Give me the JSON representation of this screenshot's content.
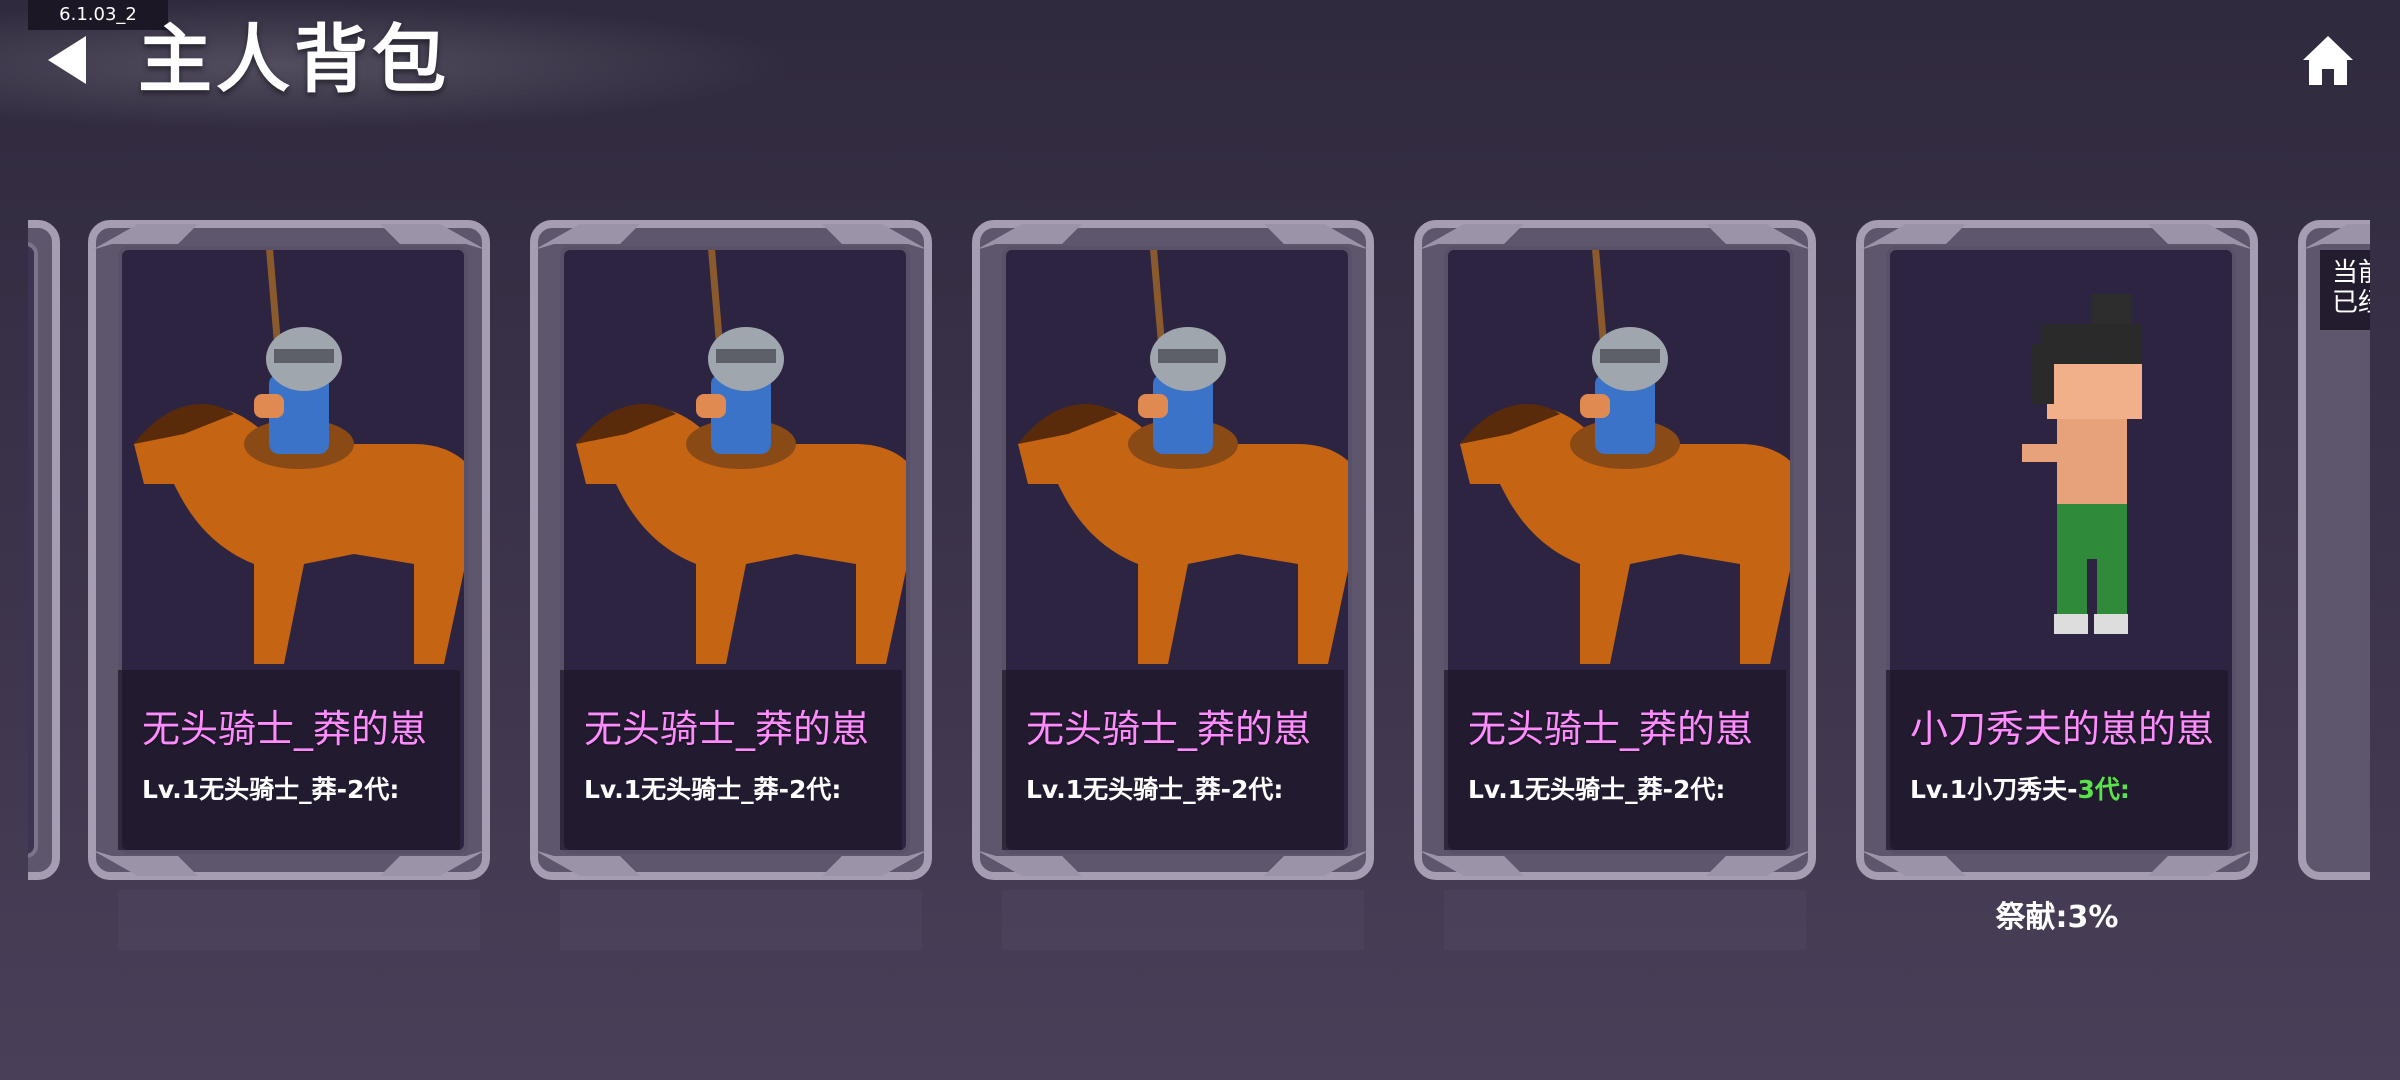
{
  "version": "6.1.03_2",
  "header": {
    "title": "主人背包"
  },
  "cards": [
    {
      "name": "无头骑士_莽的崽",
      "level_prefix": "Lv.1无头骑士_莽-2代:",
      "level_suffix": "",
      "figure": "horse-knight-figure"
    },
    {
      "name": "无头骑士_莽的崽",
      "level_prefix": "Lv.1无头骑士_莽-2代:",
      "level_suffix": "",
      "figure": "horse-knight-figure"
    },
    {
      "name": "无头骑士_莽的崽",
      "level_prefix": "Lv.1无头骑士_莽-2代:",
      "level_suffix": "",
      "figure": "horse-knight-figure"
    },
    {
      "name": "无头骑士_莽的崽",
      "level_prefix": "Lv.1无头骑士_莽-2代:",
      "level_suffix": "",
      "figure": "horse-knight-figure"
    },
    {
      "name": "小刀秀夫的崽的崽",
      "level_prefix": "Lv.1小刀秀夫-",
      "level_suffix": "3代:",
      "figure": "blocky-warrior-figure",
      "contribution": "祭献:3%"
    }
  ],
  "partial_card_text": "当前\n已经",
  "colors": {
    "card_name": "#ff8cff",
    "generation_highlight": "#59e34a",
    "background": "#3a3249"
  }
}
